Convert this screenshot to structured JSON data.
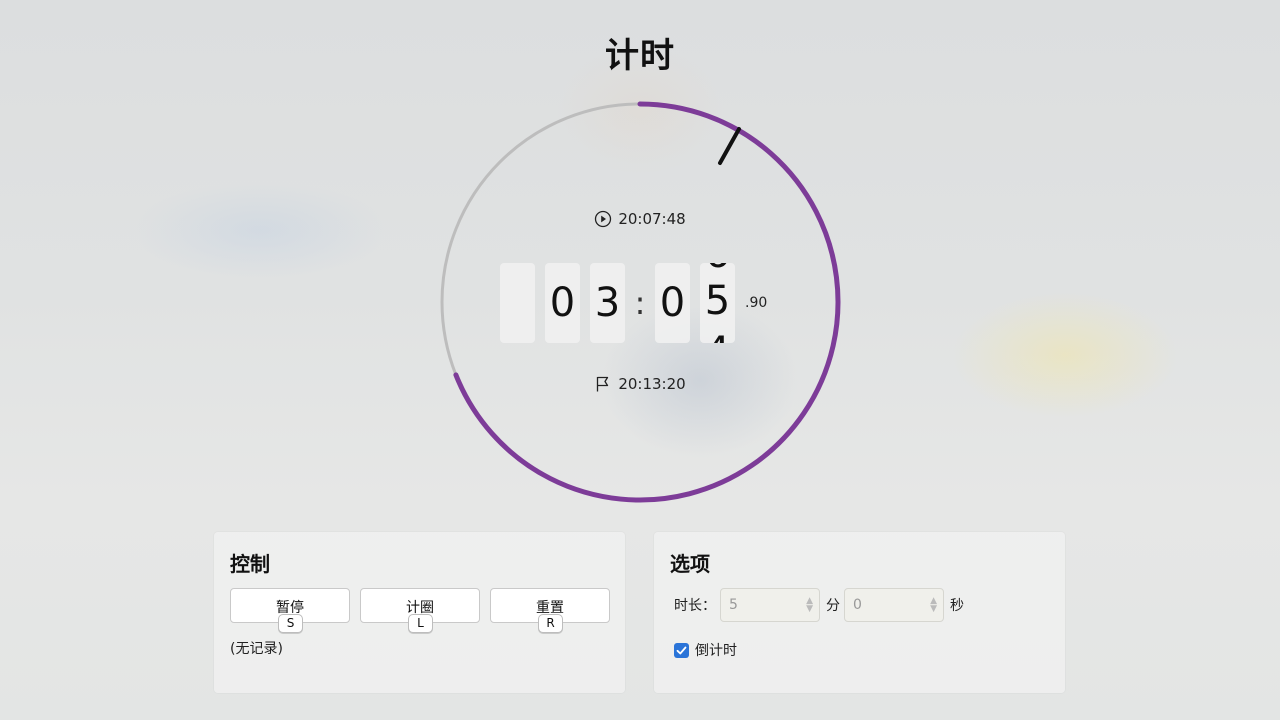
{
  "title": "计时",
  "timer": {
    "start_time": "20:07:48",
    "end_time": "20:13:20",
    "digits": [
      "",
      "0",
      "3",
      "0",
      "5"
    ],
    "rolling_digit": {
      "prev": "6",
      "current": "5",
      "next": "4"
    },
    "separator": ":",
    "millis": ".90",
    "progress_fraction": 0.69,
    "accent_color": "#7d3c98",
    "track_color": "#bdbdbd",
    "icons": {
      "start": "play-circle-icon",
      "end": "flag-icon"
    }
  },
  "controls": {
    "heading": "控制",
    "buttons": [
      {
        "label": "暂停",
        "key": "S"
      },
      {
        "label": "计圈",
        "key": "L"
      },
      {
        "label": "重置",
        "key": "R"
      }
    ],
    "laps_text": "(无记录)"
  },
  "options": {
    "heading": "选项",
    "duration_label": "时长：",
    "minutes_value": "5",
    "minutes_unit": "分",
    "seconds_value": "0",
    "seconds_unit": "秒",
    "countdown_label": "倒计时",
    "countdown_checked": true
  }
}
